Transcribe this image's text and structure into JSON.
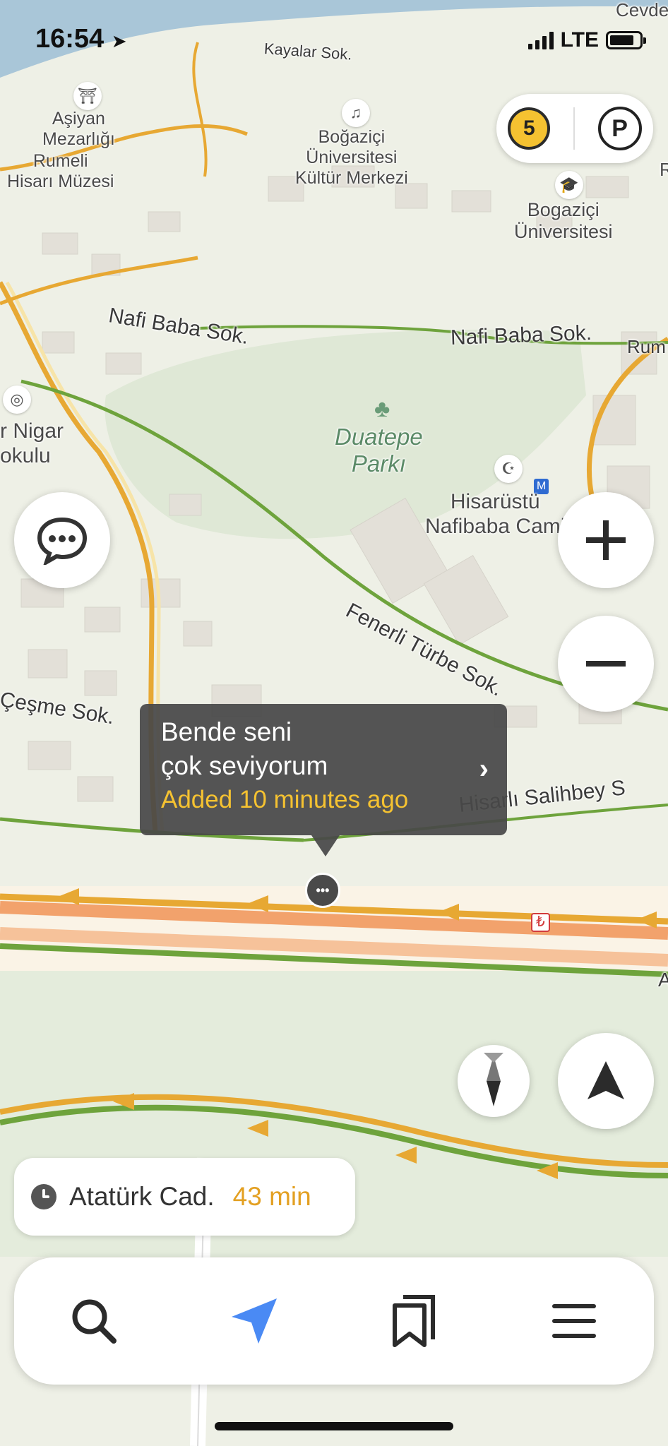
{
  "status_bar": {
    "time": "16:54",
    "network": "LTE"
  },
  "map": {
    "labels": {
      "asiyan": "Aşiyan\nMezarlığı",
      "rumeli": "Rumeli\nHisarı Müzesi",
      "bogazici_kultur": "Boğaziçi\nÜniversitesi\nKültür Merkezi",
      "bogazici_uni": "Bogaziçi\nÜniversitesi",
      "duatepe": "Duatepe\nParkı",
      "hisarustu": "Hisarüstü\nNafibaba Cami",
      "nigar": "r Nigar\nokulu",
      "cevde": "Cevde",
      "r_edge": "R"
    },
    "streets": {
      "kayalar": "Kayalar Sok.",
      "nafi_baba_1": "Nafi Baba Sok.",
      "nafi_baba_2": "Nafi Baba Sok.",
      "rum": "Rum",
      "fenerli": "Fenerli Türbe Sok.",
      "cesme": "Çeşme Sok.",
      "hisarli": "Hisarlı Salihbey S",
      "a_edge": "A"
    }
  },
  "traffic": {
    "score": "5",
    "parking_label": "P"
  },
  "tooltip": {
    "title": "Bende seni\nçok seviyorum",
    "subtitle": "Added 10 minutes ago"
  },
  "route_eta": {
    "destination": "Atatürk Cad.",
    "time": "43 min"
  },
  "bottom_nav": [
    "search",
    "navigation",
    "bookmarks",
    "menu"
  ],
  "colors": {
    "accent_yellow": "#f5c231",
    "eta_orange": "#e3a022",
    "nav_blue": "#4a8af4",
    "road_orange": "#f2a26c",
    "road_green": "#6ea33c",
    "park_green": "#dfe8d6"
  }
}
